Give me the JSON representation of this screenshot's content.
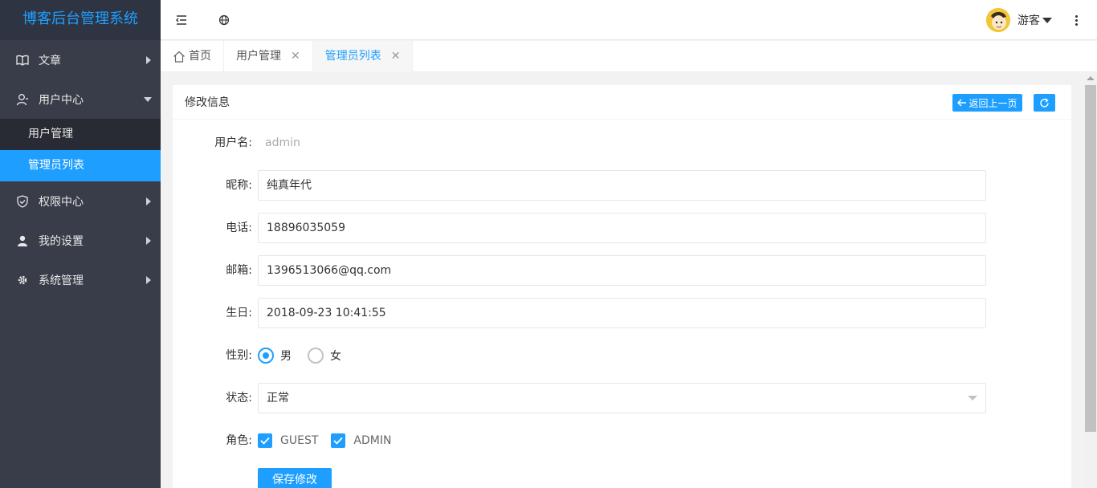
{
  "app": {
    "title": "博客后台管理系统"
  },
  "sidebar": {
    "items": [
      {
        "label": "文章",
        "icon": "book-icon"
      },
      {
        "label": "用户中心",
        "icon": "user-outline-icon",
        "expanded": true,
        "children": [
          {
            "label": "用户管理"
          },
          {
            "label": "管理员列表",
            "active": true
          }
        ]
      },
      {
        "label": "权限中心",
        "icon": "shield-icon"
      },
      {
        "label": "我的设置",
        "icon": "person-icon"
      },
      {
        "label": "系统管理",
        "icon": "gear-icon"
      }
    ]
  },
  "header": {
    "user_name": "游客"
  },
  "tabs": [
    {
      "label": "首页"
    },
    {
      "label": "用户管理"
    },
    {
      "label": "管理员列表",
      "active": true
    }
  ],
  "card": {
    "title": "修改信息",
    "back_label": "返回上一页"
  },
  "form": {
    "username_label": "用户名:",
    "username_value": "admin",
    "nickname_label": "昵称:",
    "nickname_value": "纯真年代",
    "phone_label": "电话:",
    "phone_value": "18896035059",
    "email_label": "邮箱:",
    "email_value": "1396513066@qq.com",
    "birthday_label": "生日:",
    "birthday_value": "2018-09-23 10:41:55",
    "gender_label": "性别:",
    "gender_options": [
      "男",
      "女"
    ],
    "gender_selected": "男",
    "status_label": "状态:",
    "status_value": "正常",
    "role_label": "角色:",
    "roles": [
      "GUEST",
      "ADMIN"
    ],
    "submit_label": "保存修改"
  },
  "colors": {
    "accent": "#1e9fff",
    "sidebar_bg": "#393d49"
  }
}
